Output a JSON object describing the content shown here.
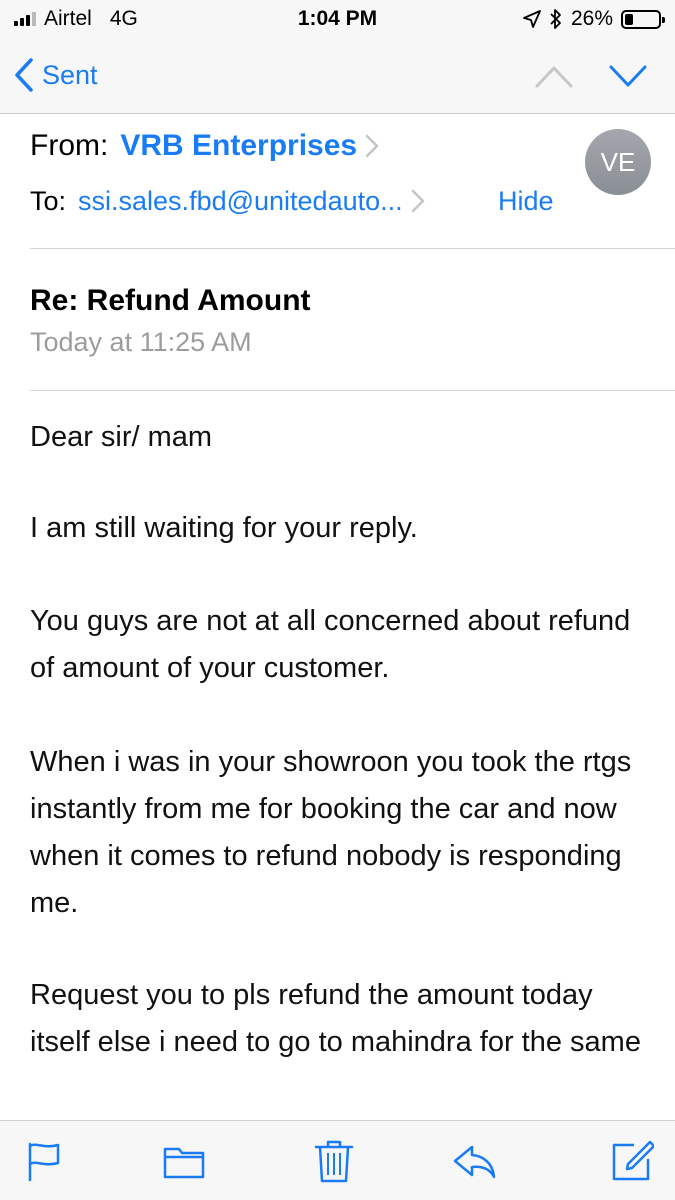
{
  "status_bar": {
    "carrier": "Airtel",
    "network": "4G",
    "time": "1:04 PM",
    "battery": "26%",
    "battery_level": 0.26
  },
  "nav": {
    "back_label": "Sent",
    "accent_color": "#1a7cf5"
  },
  "header": {
    "from_label": "From:",
    "from_name": "VRB Enterprises",
    "to_label": "To:",
    "to_address": "ssi.sales.fbd@unitedauto...",
    "hide_label": "Hide",
    "avatar_initials": "VE"
  },
  "message": {
    "subject": "Re: Refund Amount",
    "date": "Today at 11:25 AM",
    "paragraphs": [
      "Dear sir/ mam",
      "I am still waiting for your reply.",
      "You guys are not at all concerned about refund of amount of your customer.",
      "When i was in your showroon you took the rtgs instantly from me for booking the car and now when it comes to refund nobody is responding me.",
      "Request you to pls refund the amount today itself else i need to go to mahindra for the same"
    ]
  },
  "toolbar": {
    "icons": [
      "flag-icon",
      "folder-icon",
      "trash-icon",
      "reply-icon",
      "compose-icon"
    ]
  }
}
